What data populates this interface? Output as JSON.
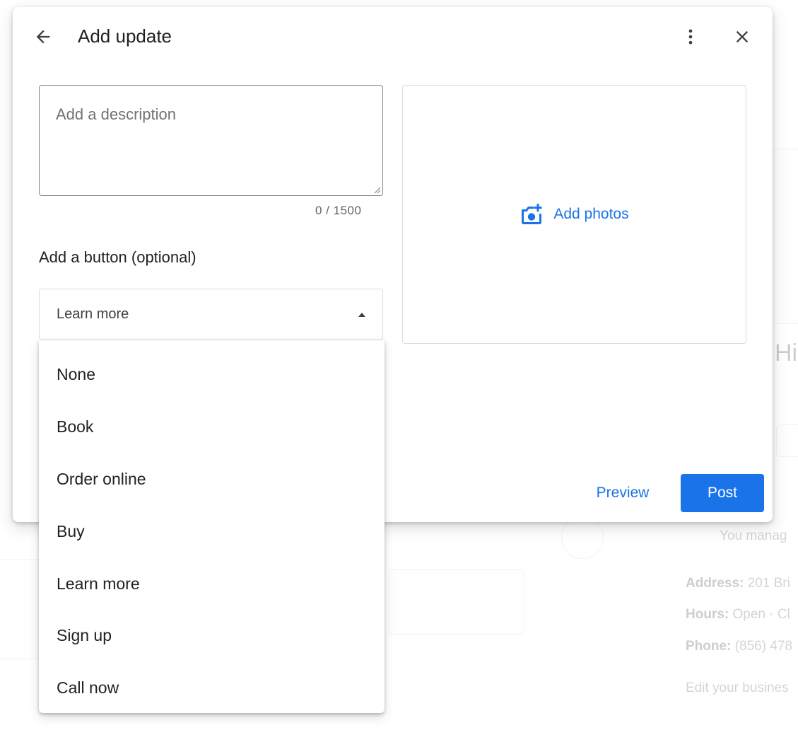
{
  "dialog": {
    "title": "Add update",
    "back_icon": "arrow-back-icon",
    "more_icon": "more-vert-icon",
    "close_icon": "close-icon",
    "description": {
      "placeholder": "Add a description",
      "value": "",
      "counter": "0 / 1500"
    },
    "button_section_label": "Add a button (optional)",
    "button_select": {
      "selected": "Learn more",
      "expanded": true,
      "options": [
        "None",
        "Book",
        "Order online",
        "Buy",
        "Learn more",
        "Sign up",
        "Call now"
      ]
    },
    "photos": {
      "label": "Add photos",
      "icon": "add-photo-camera-icon"
    },
    "preview_label": "Preview",
    "post_label": "Post"
  },
  "colors": {
    "accent": "#1a73e8",
    "text_primary": "#202124",
    "text_secondary": "#5f6368",
    "border": "#dadce0"
  }
}
